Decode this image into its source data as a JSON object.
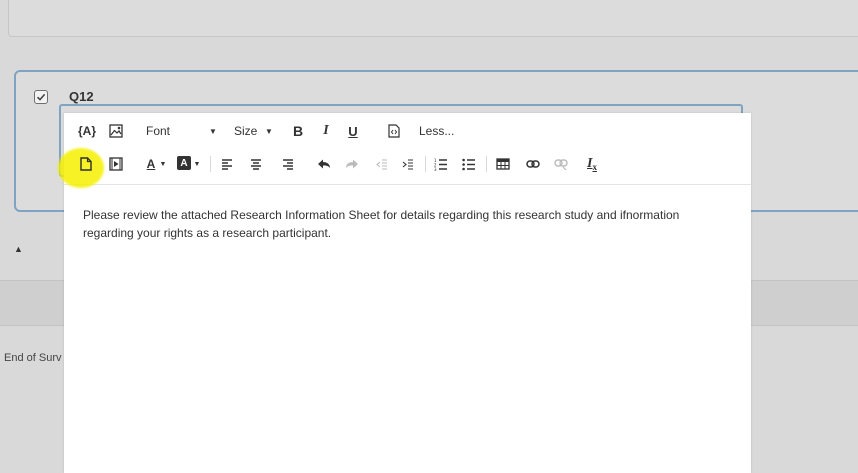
{
  "question": {
    "label": "Q12"
  },
  "toolbar": {
    "piped_text": "{A}",
    "font": "Font",
    "size": "Size",
    "bold": "B",
    "italic": "I",
    "underline": "U",
    "less": "Less...",
    "text_color": "A",
    "bg_color": "A",
    "remove_format": "I",
    "remove_format_sub": "x"
  },
  "editor": {
    "content": "Please review the attached Research Information Sheet for details regarding this research study and ifnormation regarding your rights as a research participant."
  },
  "footer": {
    "end_of_survey": "End of Surv"
  },
  "colors": {
    "accent_border": "#7fa3c3",
    "highlight": "#f5f000",
    "background": "#d9d9d9"
  }
}
